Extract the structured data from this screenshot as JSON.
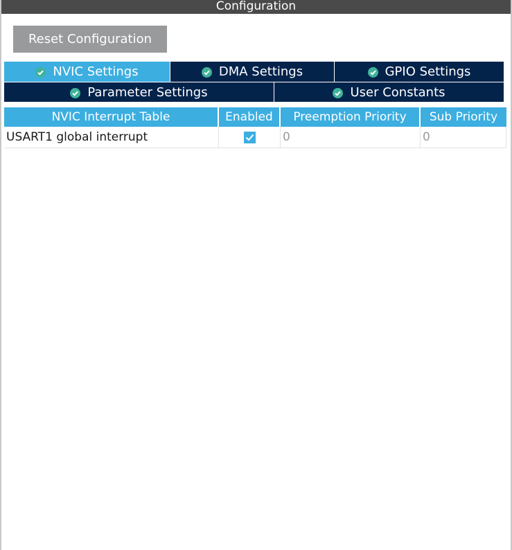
{
  "panel": {
    "title": "Configuration"
  },
  "toolbar": {
    "reset_label": "Reset Configuration"
  },
  "tabs": {
    "row1": [
      {
        "label": "NVIC Settings",
        "icon": "check-circle-icon",
        "active": true
      },
      {
        "label": "DMA Settings",
        "icon": "check-circle-icon",
        "active": false
      },
      {
        "label": "GPIO Settings",
        "icon": "check-circle-icon",
        "active": false
      }
    ],
    "row2": [
      {
        "label": "Parameter Settings",
        "icon": "check-circle-icon",
        "active": false
      },
      {
        "label": "User Constants",
        "icon": "check-circle-icon",
        "active": false
      }
    ]
  },
  "nvic_table": {
    "columns": [
      "NVIC Interrupt Table",
      "Enabled",
      "Preemption Priority",
      "Sub Priority"
    ],
    "rows": [
      {
        "name": "USART1 global interrupt",
        "enabled": true,
        "preemption_priority": "0",
        "sub_priority": "0"
      }
    ]
  },
  "colors": {
    "title_bar": "#4a4a4a",
    "button_gray": "#999a9c",
    "tab_dark": "#03234b",
    "accent_blue": "#3caee0"
  }
}
